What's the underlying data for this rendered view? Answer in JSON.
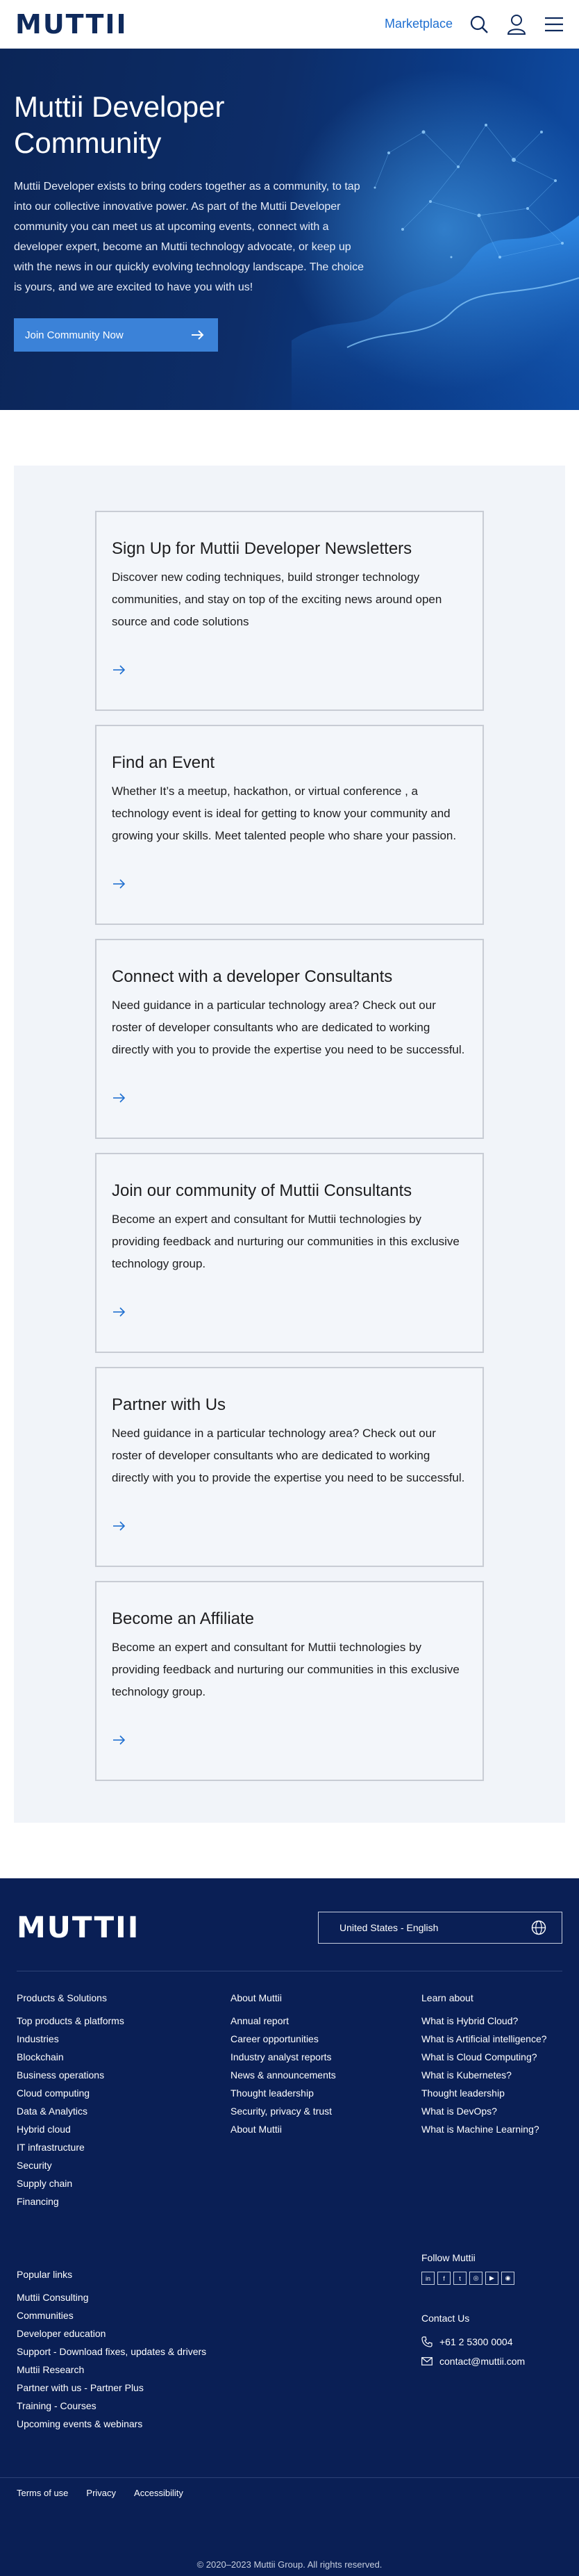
{
  "header": {
    "logo": "MUTTII",
    "marketplace": "Marketplace",
    "search_icon": "search-icon",
    "user_icon": "user-icon",
    "menu_icon": "hamburger-menu-icon"
  },
  "hero": {
    "title": "Muttii Developer Community",
    "body": "Muttii Developer exists to bring coders together as a community, to tap into our collective innovative power. As part of the Muttii Developer community you can meet us at upcoming events, connect with a developer expert, become an Muttii technology advocate, or keep up with the news in our quickly evolving technology landscape. The choice is yours, and we are excited to have you with us!",
    "cta": "Join Community Now"
  },
  "cards": [
    {
      "title": "Sign Up for Muttii Developer Newsletters",
      "body": "Discover new coding techniques, build stronger technology communities, and stay on top of the exciting news around open source and code solutions"
    },
    {
      "title": "Find an Event",
      "body": "Whether It’s a meetup, hackathon, or virtual conference , a technology event is ideal for getting to know your community and growing your skills. Meet talented people who share your passion."
    },
    {
      "title": "Connect with a developer Consultants",
      "body": "Need guidance in  a particular technology area? Check out our roster of developer consultants who are dedicated to working directly with you to provide the expertise you need to be successful."
    },
    {
      "title": "Join our community of Muttii Consultants",
      "body": "Become an expert and consultant for Muttii technologies by providing feedback and nurturing our communities in this exclusive technology group."
    },
    {
      "title": "Partner with Us",
      "body": "Need guidance in  a particular technology area? Check out our roster of developer consultants who are dedicated to working directly with you to provide the expertise you need to be successful."
    },
    {
      "title": "Become an Affiliate",
      "body": "Become an expert and consultant for Muttii technologies by providing feedback and nurturing our communities in this exclusive technology group."
    }
  ],
  "footer": {
    "logo": "MUTTII",
    "locale": "United States - English",
    "products": {
      "heading": "Products & Solutions",
      "links": [
        "Top products & platforms",
        "Industries",
        "Blockchain",
        "Business operations",
        "Cloud computing",
        "Data & Analytics",
        "Hybrid cloud",
        "IT infrastructure",
        "Security",
        "Supply chain",
        "Financing"
      ]
    },
    "about": {
      "heading": "About Muttii",
      "links": [
        "Annual report",
        "Career opportunities",
        "Industry analyst reports",
        "News & announcements",
        "Thought leadership",
        "Security, privacy & trust",
        "About Muttii"
      ]
    },
    "learn": {
      "heading": "Learn about",
      "links": [
        "What is Hybrid Cloud?",
        "What is Artificial intelligence?",
        "What is Cloud Computing?",
        "What is Kubernetes?",
        "Thought leadership",
        "What is DevOps?",
        "What is Machine Learning?"
      ]
    },
    "popular": {
      "heading": "Popular links",
      "links": [
        "Muttii Consulting",
        "Communities",
        "Developer education",
        "Support - Download fixes, updates & drivers",
        "Muttii Research",
        "Partner with us - Partner Plus",
        "Training - Courses",
        "Upcoming events & webinars"
      ]
    },
    "follow": {
      "heading": "Follow Muttii",
      "icons": [
        {
          "name": "linkedin-icon",
          "glyph": "in"
        },
        {
          "name": "facebook-icon",
          "glyph": "f"
        },
        {
          "name": "twitter-icon",
          "glyph": "t"
        },
        {
          "name": "instagram-icon",
          "glyph": "◎"
        },
        {
          "name": "youtube-icon",
          "glyph": "▶"
        },
        {
          "name": "rss-icon",
          "glyph": "◉"
        }
      ]
    },
    "contact": {
      "heading": "Contact Us",
      "phone": "+61 2 5300 0004",
      "email": "contact@muttii.com"
    },
    "legal": [
      "Terms of use",
      "Privacy",
      "Accessibility"
    ],
    "copyright": "© 2020–2023 Muttii Group. All rights reserved."
  },
  "colors": {
    "brand_navy": "#0a1f55",
    "accent_blue": "#1f6fd0",
    "cta_blue": "#3b82d8"
  }
}
